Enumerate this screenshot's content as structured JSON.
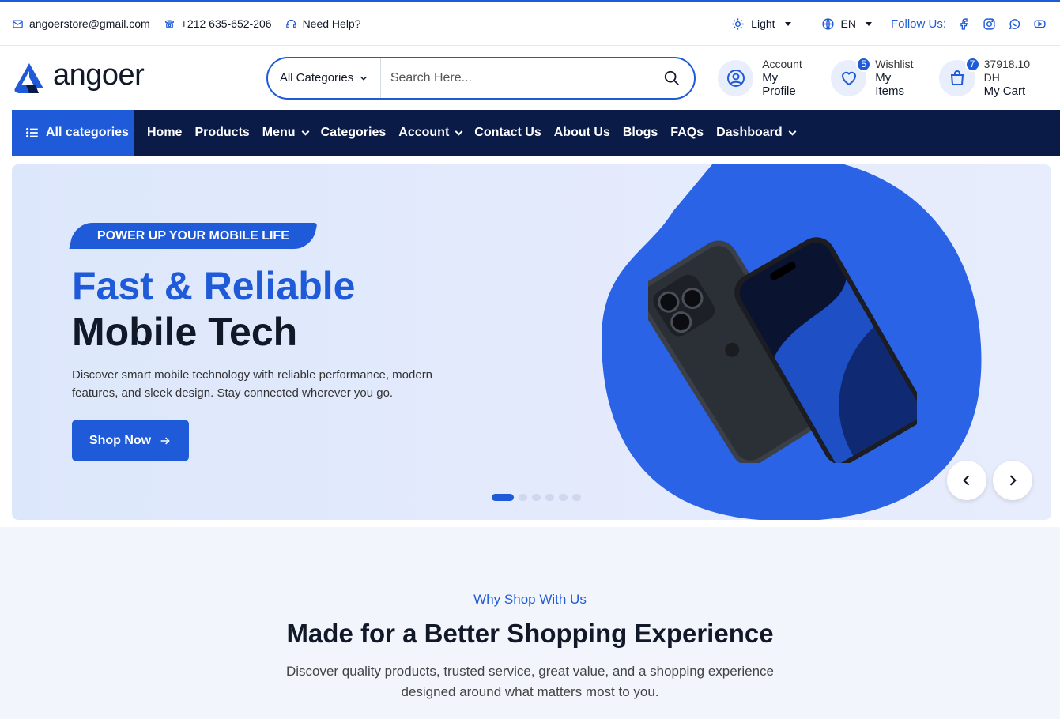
{
  "topbar": {
    "email": "angoerstore@gmail.com",
    "phone": "+212 635-652-206",
    "help": "Need Help?",
    "theme": "Light",
    "language": "EN",
    "follow_label": "Follow Us:",
    "social_icons": [
      "facebook-icon",
      "instagram-icon",
      "whatsapp-icon",
      "youtube-icon"
    ]
  },
  "header": {
    "logo_text": "angoer",
    "search_category": "All Categories",
    "search_placeholder": "Search Here...",
    "account": {
      "label": "Account",
      "value": "My Profile"
    },
    "wishlist": {
      "label": "Wishlist",
      "value": "My Items",
      "count": "5"
    },
    "cart": {
      "label": "37918.10 DH",
      "value": "My Cart",
      "count": "7"
    }
  },
  "nav": {
    "all_categories": "All categories",
    "links": [
      "Home",
      "Products",
      "Menu",
      "Categories",
      "Account",
      "Contact Us",
      "About Us",
      "Blogs",
      "FAQs",
      "Dashboard"
    ]
  },
  "hero": {
    "tag": "POWER UP YOUR MOBILE LIFE",
    "title_line1": "Fast & Reliable",
    "title_line2": "Mobile Tech",
    "description": "Discover smart mobile technology with reliable performance, modern features, and sleek design. Stay connected wherever you go.",
    "button": "Shop Now",
    "slides": 6,
    "active_slide": 1
  },
  "why": {
    "kicker": "Why Shop With Us",
    "title": "Made for a Better Shopping Experience",
    "description": "Discover quality products, trusted service, great value, and a shopping experience designed around what matters most to you."
  },
  "colors": {
    "accent": "#1f5bd8",
    "nav_bg": "#0b1b48",
    "section_bg": "#f2f5fb"
  }
}
